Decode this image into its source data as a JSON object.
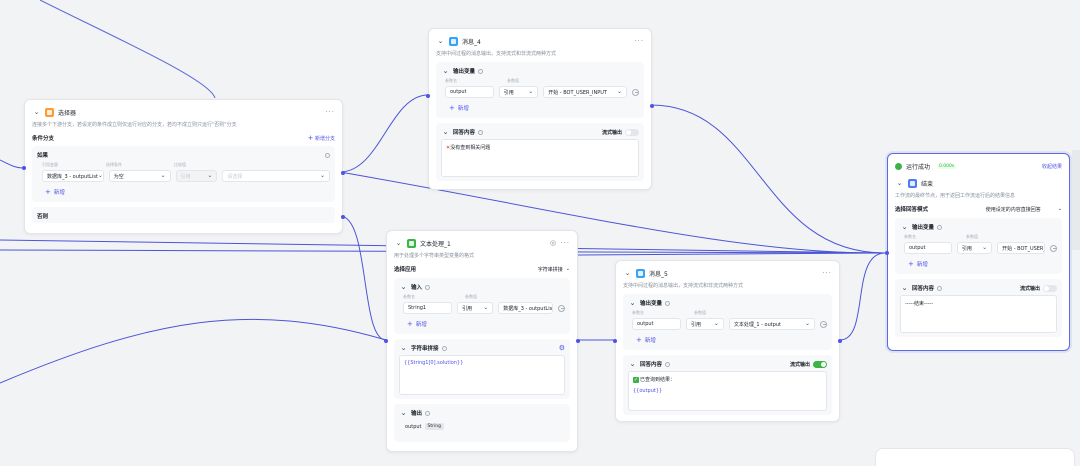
{
  "colors": {
    "accent": "#4d53e8",
    "wire": "#4b55d6",
    "success": "#3bb346",
    "selector_icon": "#ff9a2e",
    "message_icon": "#36a3f7",
    "text_icon": "#3bb346",
    "end_icon": "#4d7cf5"
  },
  "selector": {
    "title": "选择器",
    "desc": "连接多个下游分支，若设定的条件成立则仅运行对应的分支，若均不成立则只运行\"否则\"分支",
    "branch_label": "条件分支",
    "add_branch": "新增分支",
    "if_label": "如果",
    "col_var": "引用变量",
    "col_op": "选择条件",
    "col_val": "比较值",
    "row_var": "数据库_3 - outputList",
    "row_op": "为空",
    "row_type": "引用",
    "row_val_placeholder": "请选择",
    "add_label": "新增",
    "else_label": "否则"
  },
  "msg4": {
    "title": "消息_4",
    "desc": "支持中间过程的消息输出，支持流式和非流式两种方式",
    "out_label": "输出变量",
    "col_name": "参数名",
    "col_val": "参数值",
    "var_name": "output",
    "var_type": "引用",
    "var_value": "开始 - BOT_USER_INPUT",
    "add_label": "新增",
    "reply_label": "回答内容",
    "stream_label": "流式输出",
    "reply_mark": "✕",
    "reply_text": "没有查到相关问题"
  },
  "text1": {
    "title": "文本处理_1",
    "desc": "用于处理多个字符串类型变量的格式",
    "app_label": "选择应用",
    "app_value": "字符串拼接",
    "input_label": "输入",
    "col_name": "参数名",
    "col_val": "参数值",
    "var_name": "String1",
    "var_type": "引用",
    "var_value": "数据库_3 - outputList",
    "add_label": "新增",
    "concat_label": "字符串拼接",
    "concat_text": "{{String1[0].solution}}",
    "output_label": "输出",
    "output_name": "output",
    "output_type": "String"
  },
  "msg5": {
    "title": "消息_5",
    "desc": "支持中间过程的消息输出，支持流式和非流式两种方式",
    "out_label": "输出变量",
    "col_name": "参数名",
    "col_val": "参数值",
    "var_name": "output",
    "var_type": "引用",
    "var_value": "文本处理_1 - output",
    "add_label": "新增",
    "reply_label": "回答内容",
    "stream_label": "流式输出",
    "reply_mark": "✓",
    "reply_line1": "已查询到结果：",
    "reply_line2": "{{output}}"
  },
  "end": {
    "status": "运行成功",
    "time": "0.000s",
    "collapse_result": "收起结果",
    "title": "结束",
    "desc": "工作流的最终节点，用于返回工作流运行后的结果信息",
    "mode_label": "选择回答模式",
    "mode_value": "使用设定的内容直接回答",
    "out_label": "输出变量",
    "col_name": "参数名",
    "col_val": "参数值",
    "var_name": "output",
    "var_type": "引用",
    "var_value": "开始 - BOT_USER_INPUT",
    "add_label": "新增",
    "reply_label": "回答内容",
    "stream_label": "流式输出",
    "reply_text": "-----结束-----"
  }
}
